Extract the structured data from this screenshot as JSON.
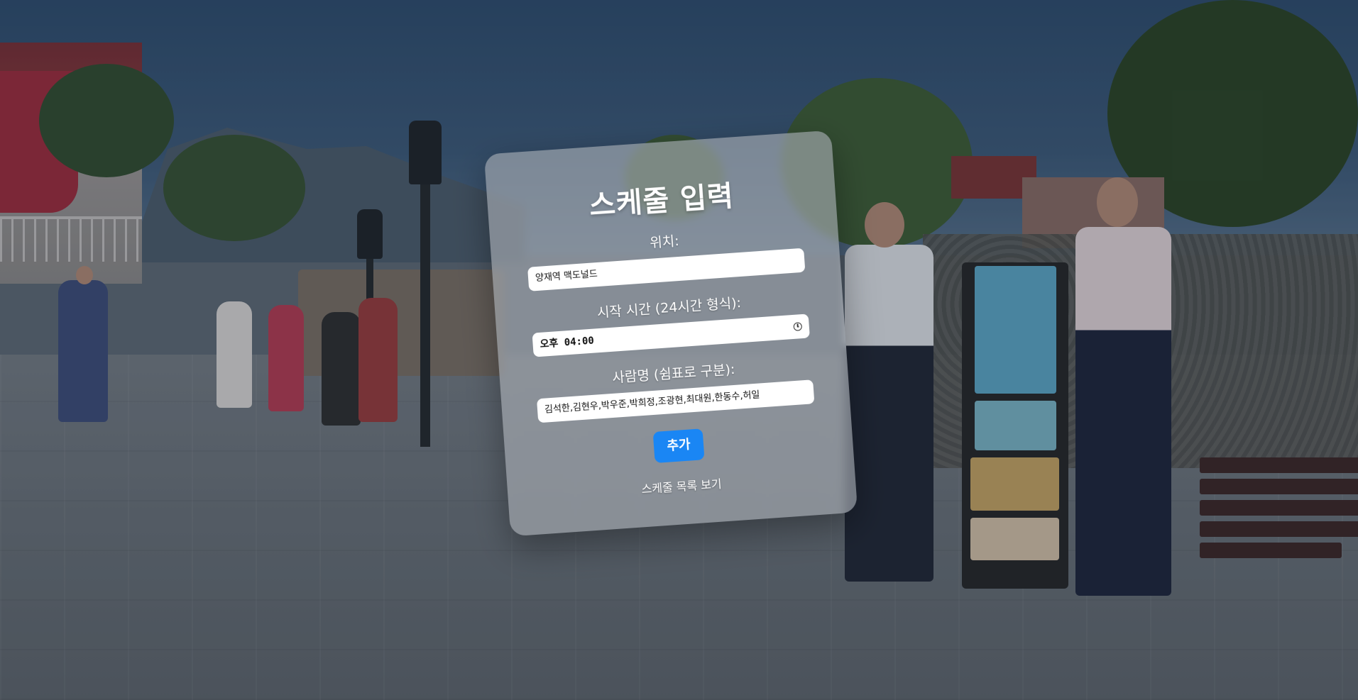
{
  "form": {
    "title": "스케줄 입력",
    "location_label": "위치:",
    "location_value": "양재역 맥도널드",
    "start_time_label": "시작 시간 (24시간 형식):",
    "start_time_value": "오후 04:00",
    "people_label": "사람명 (쉼표로 구분):",
    "people_value": "김석한,김현우,박우준,박희정,조광현,최대원,한동수,허일",
    "add_button_label": "추가",
    "view_list_link": "스케줄 목록 보기"
  },
  "theme": {
    "button_color": "#1a86f4",
    "card_tint": "rgba(170,175,180,0.62)"
  },
  "icons": {
    "time_input_icon": "clock-icon"
  }
}
